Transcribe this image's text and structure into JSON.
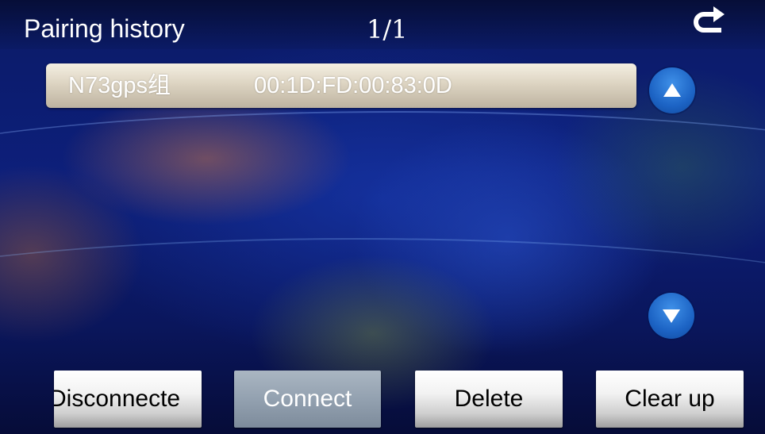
{
  "header": {
    "title": "Pairing history",
    "page_indicator": "1/1",
    "back_icon": "return-arrow-icon"
  },
  "devices": [
    {
      "name": "N73gps组",
      "address": "00:1D:FD:00:83:0D"
    }
  ],
  "scroll": {
    "up_icon": "triangle-up-icon",
    "down_icon": "triangle-down-icon"
  },
  "actions": {
    "disconnect_label": "Disconnecte",
    "connect_label": "Connect",
    "delete_label": "Delete",
    "clear_label": "Clear up"
  },
  "colors": {
    "background": "#0d1f7a",
    "scroll_button": "#1c63c4",
    "row_highlight": "#ddd4c2",
    "connect_disabled": "#93a1b0"
  }
}
